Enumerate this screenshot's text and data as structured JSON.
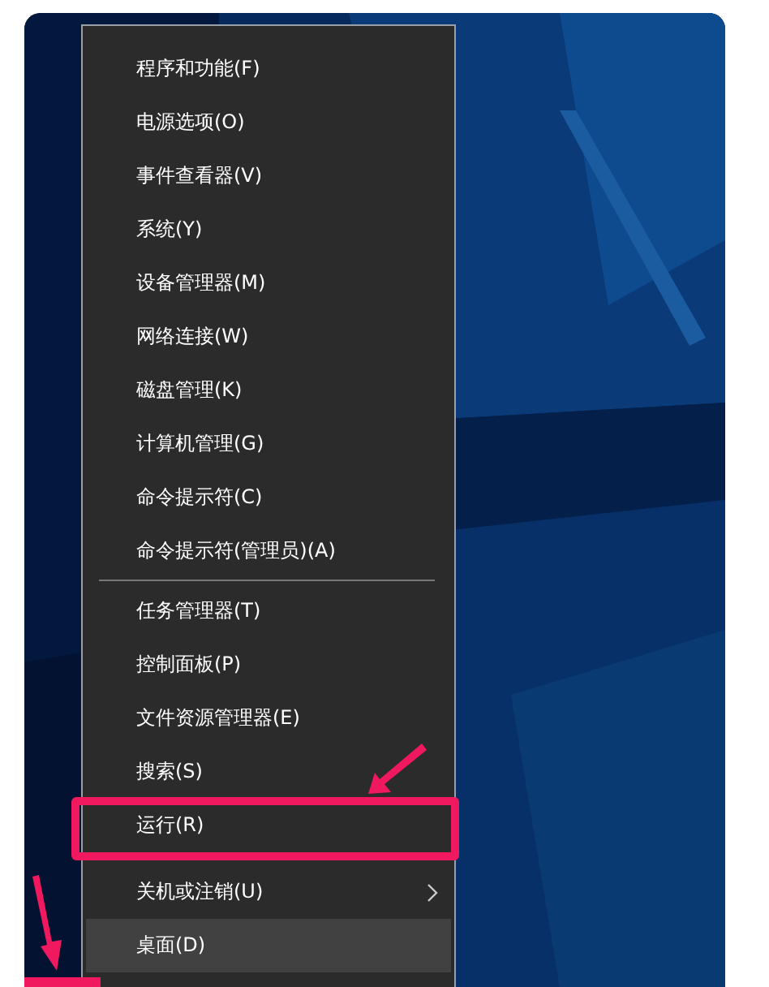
{
  "menu": {
    "sections": [
      {
        "divider_before": false,
        "items": [
          {
            "label": "程序和功能(F)",
            "selected": false,
            "submenu": false,
            "marked": false
          },
          {
            "label": "电源选项(O)",
            "selected": false,
            "submenu": false,
            "marked": false
          },
          {
            "label": "事件查看器(V)",
            "selected": false,
            "submenu": false,
            "marked": false
          },
          {
            "label": "系统(Y)",
            "selected": false,
            "submenu": false,
            "marked": false
          },
          {
            "label": "设备管理器(M)",
            "selected": false,
            "submenu": false,
            "marked": false
          },
          {
            "label": "网络连接(W)",
            "selected": false,
            "submenu": false,
            "marked": false
          },
          {
            "label": "磁盘管理(K)",
            "selected": false,
            "submenu": false,
            "marked": false
          },
          {
            "label": "计算机管理(G)",
            "selected": false,
            "submenu": false,
            "marked": false
          },
          {
            "label": "命令提示符(C)",
            "selected": false,
            "submenu": false,
            "marked": false
          },
          {
            "label": "命令提示符(管理员)(A)",
            "selected": false,
            "submenu": false,
            "marked": false
          }
        ]
      },
      {
        "divider_before": true,
        "items": [
          {
            "label": "任务管理器(T)",
            "selected": false,
            "submenu": false,
            "marked": false
          },
          {
            "label": "控制面板(P)",
            "selected": false,
            "submenu": false,
            "marked": false
          },
          {
            "label": "文件资源管理器(E)",
            "selected": false,
            "submenu": false,
            "marked": false
          },
          {
            "label": "搜索(S)",
            "selected": false,
            "submenu": false,
            "marked": false
          },
          {
            "label": "运行(R)",
            "selected": false,
            "submenu": false,
            "marked": true
          }
        ]
      },
      {
        "divider_before": false,
        "items": [
          {
            "label": "关机或注销(U)",
            "selected": false,
            "submenu": true,
            "marked": false
          },
          {
            "label": "桌面(D)",
            "selected": true,
            "submenu": false,
            "marked": false
          }
        ]
      }
    ]
  },
  "start_button": {
    "marked": true
  }
}
